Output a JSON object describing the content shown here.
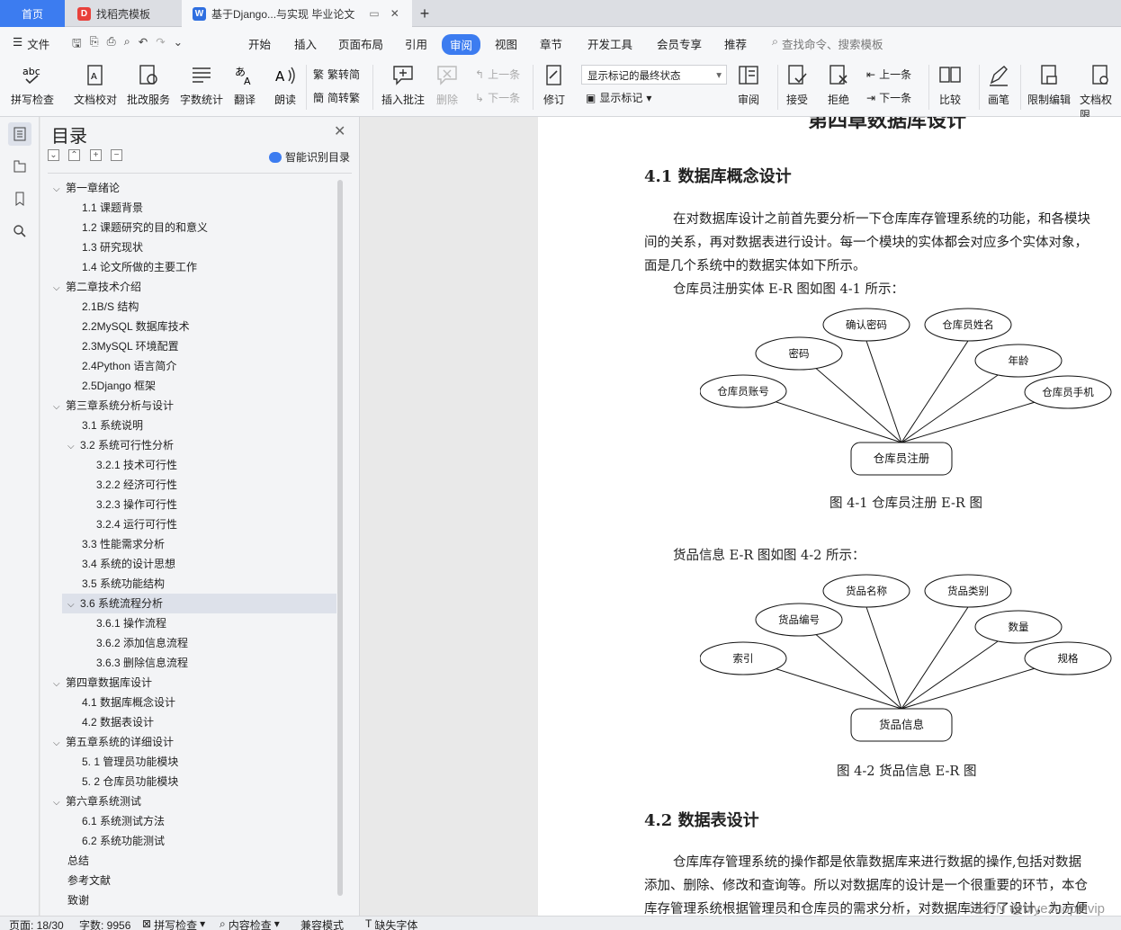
{
  "tabs": {
    "home": "首页",
    "template": "找稻壳模板",
    "doc": "基于Django...与实现 毕业论文"
  },
  "menu": {
    "file": "文件",
    "items": [
      "开始",
      "插入",
      "页面布局",
      "引用",
      "审阅",
      "视图",
      "章节",
      "开发工具",
      "会员专享",
      "推荐"
    ],
    "search": "查找命令、搜索模板"
  },
  "ribbon": {
    "spell": "拼写检查",
    "proof": "文档校对",
    "annotate_service": "批改服务",
    "wordcount": "字数统计",
    "translate": "翻译",
    "read": "朗读",
    "trad": "繁转简",
    "simp": "简转繁",
    "insert_comment": "插入批注",
    "delete": "删除",
    "prev": "上一条",
    "next": "下一条",
    "revise": "修订",
    "final_state": "显示标记的最终状态",
    "show_marks": "显示标记",
    "review": "审阅",
    "accept": "接受",
    "reject": "拒绝",
    "prev2": "上一条",
    "next2": "下一条",
    "compare": "比较",
    "pen": "画笔",
    "restrict": "限制编辑",
    "perm": "文档权限"
  },
  "toc": {
    "title": "目录",
    "smart": "智能识别目录",
    "items": [
      "第一章绪论",
      "1.1 课题背景",
      "1.2 课题研究的目的和意义",
      "1.3  研究现状",
      "1.4 论文所做的主要工作",
      "第二章技术介绍",
      "2.1B/S 结构",
      "2.2MySQL 数据库技术",
      "2.3MySQL 环境配置",
      "2.4Python 语言简介",
      "2.5Django 框架",
      "第三章系统分析与设计",
      "3.1 系统说明",
      "3.2 系统可行性分析",
      "3.2.1  技术可行性",
      "3.2.2  经济可行性",
      "3.2.3 操作可行性",
      "3.2.4 运行可行性",
      "3.3  性能需求分析",
      "3.4 系统的设计思想",
      "3.5 系统功能结构",
      "3.6 系统流程分析",
      "3.6.1 操作流程",
      "3.6.2 添加信息流程",
      "3.6.3 删除信息流程",
      "第四章数据库设计",
      "4.1 数据库概念设计",
      "4.2 数据表设计",
      "第五章系统的详细设计",
      "5. 1 管理员功能模块",
      "5. 2 仓库员功能模块",
      "第六章系统测试",
      "6.1 系统测试方法",
      "6.2 系统功能测试",
      "总结",
      "参考文献",
      "致谢"
    ]
  },
  "doc": {
    "chapter_title": "第四章数据库设计",
    "h41": "4.1 数据库概念设计",
    "p1a": "在对数据库设计之前首先要分析一下仓库库存管理系统的功能，和各模块",
    "p1b": "间的关系，再对数据表进行设计。每一个模块的实体都会对应多个实体对象，",
    "p1c": "面是几个系统中的数据实体如下所示。",
    "p2": "仓库员注册实体 E-R 图如图 4-1 所示：",
    "er1": {
      "center": "仓库员注册",
      "attrs": [
        "仓库员账号",
        "密码",
        "确认密码",
        "仓库员姓名",
        "年龄",
        "仓库员手机"
      ]
    },
    "cap1": "图 4-1 仓库员注册 E-R 图",
    "p3": "货品信息 E-R 图如图 4-2 所示：",
    "er2": {
      "center": "货品信息",
      "attrs": [
        "索引",
        "货品编号",
        "货品名称",
        "货品类别",
        "数量",
        "规格"
      ]
    },
    "cap2": "图 4-2 货品信息 E-R 图",
    "h42": "4.2 数据表设计",
    "p4a": "仓库库存管理系统的操作都是依靠数据库来进行数据的操作,包括对数据",
    "p4b": "添加、删除、修改和查询等。所以对数据库的设计是一个很重要的环节，本仓",
    "p4c": "库存管理系统根据管理员和仓库员的需求分析，对数据库进行了设计，为方便"
  },
  "status": {
    "page": "页面: 18/30",
    "words": "字数: 9956",
    "spell": "拼写检查",
    "content": "内容检查",
    "compat": "兼容模式",
    "font": "缺失字体"
  },
  "watermark": "CSDN @biyezuopinvip",
  "colors": {
    "accent": "#3c7cf0"
  }
}
